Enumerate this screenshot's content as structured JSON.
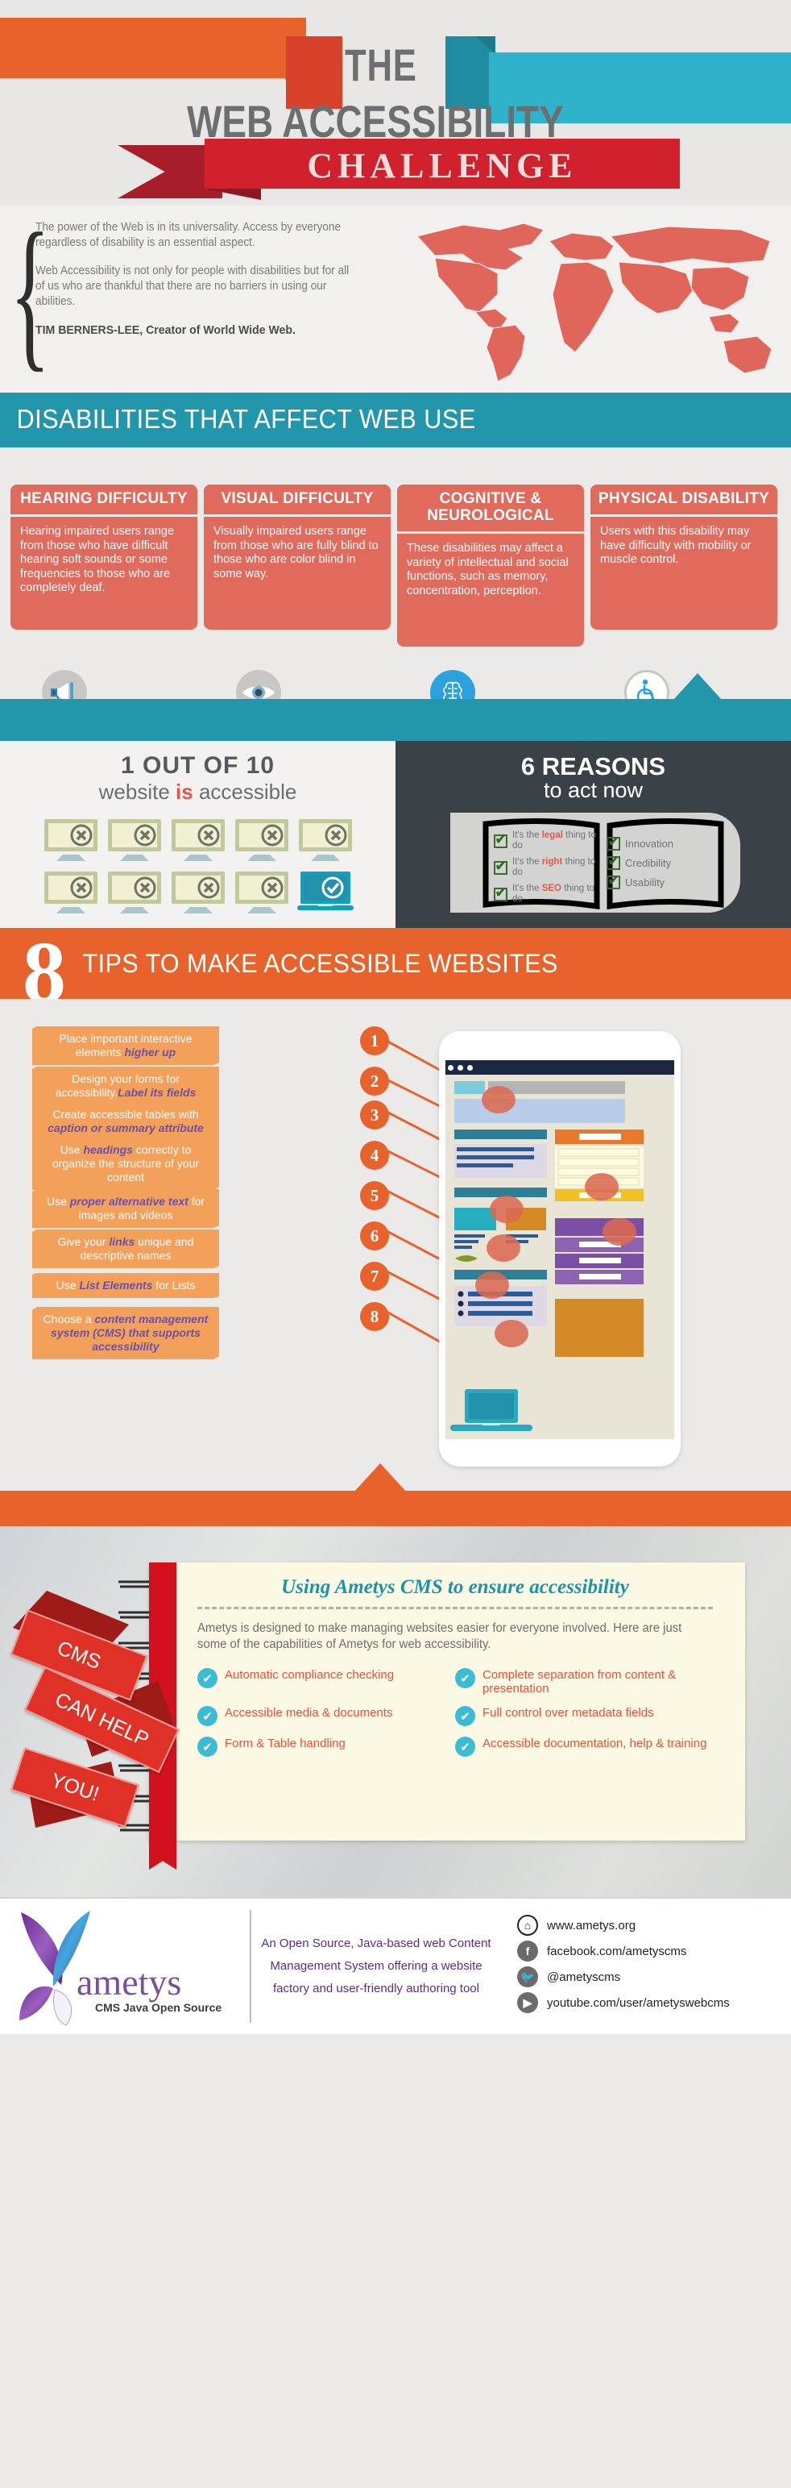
{
  "header": {
    "line1": "THE",
    "line2": "WEB ACCESSIBILITY",
    "ribbon": "CHALLENGE"
  },
  "quote": {
    "p1": "The power of the Web is in its universality. Access by everyone regardless of disability is an essential aspect.",
    "p2": "Web Accessibility is not only for people with disabilities but for all of us who are thankful that there are no barriers in using our abilities.",
    "author": "TIM BERNERS-LEE, Creator of World Wide Web.",
    "map_color": "#e0655a"
  },
  "disabilities": {
    "band_title": "DISABILITIES THAT AFFECT WEB USE",
    "band_color": "#2296ab",
    "card_color": "#e06a5c",
    "cards": [
      {
        "title": "HEARING DIFFICULTY",
        "body": "Hearing impaired users range from those who have difficult hearing soft sounds or some frequencies to those who are completely deaf.",
        "icon": "megaphone-icon"
      },
      {
        "title": "VISUAL DIFFICULTY",
        "body": "Visually impaired users range from those who are fully blind to those who are color blind in some way.",
        "icon": "eye-icon"
      },
      {
        "title": "COGNITIVE & NEUROLOGICAL",
        "body": "These disabilities may affect a variety of intellectual and social functions, such as memory, concentration, perception.",
        "icon": "brain-icon"
      },
      {
        "title": "PHYSICAL DISABILITY",
        "body": "Users with this disability may have difficulty with mobility or muscle control.",
        "icon": "wheelchair-icon"
      }
    ]
  },
  "stats": {
    "left": {
      "headline": "1 OUT OF 10",
      "sub_pre": "website ",
      "sub_hl": "is",
      "sub_post": " accessible",
      "total_monitors": 10,
      "accessible_count": 1,
      "inaccessible_count": 9
    },
    "right": {
      "headline": "6 REASONS",
      "sub": "to act now",
      "bg_color": "#3b4247",
      "reasons_left": [
        {
          "pre": "It's the ",
          "hl": "legal",
          "post": " thing to do"
        },
        {
          "pre": "It's the ",
          "hl": "right",
          "post": " thing to do"
        },
        {
          "pre": "It's the ",
          "hl": "SEO",
          "post": " thing to do"
        }
      ],
      "reasons_right": [
        {
          "pre": "",
          "hl": "",
          "post": "Innovation"
        },
        {
          "pre": "",
          "hl": "",
          "post": "Credibility"
        },
        {
          "pre": "",
          "hl": "",
          "post": "Usability"
        }
      ]
    }
  },
  "tips": {
    "big_number": "8",
    "band_title": "TIPS TO MAKE ACCESSIBLE WEBSITES",
    "band_color": "#e8622c",
    "items": [
      {
        "num": "1",
        "pre": "Place important interactive elements ",
        "em": "higher up",
        "post": ""
      },
      {
        "num": "2",
        "pre": "Design your forms for accessibility.",
        "em": "Label its fields",
        "post": ""
      },
      {
        "num": "3",
        "pre": "Create accessible tables with ",
        "em": "caption or summary attribute",
        "post": ""
      },
      {
        "num": "4",
        "pre": "Use ",
        "em": "headings",
        "post": " correctly to organize the structure of your content"
      },
      {
        "num": "5",
        "pre": "Use ",
        "em": "proper alternative text",
        "post": " for images and videos"
      },
      {
        "num": "6",
        "pre": "Give your ",
        "em": "links",
        "post": " unique and descriptive names"
      },
      {
        "num": "7",
        "pre": "Use ",
        "em": "List Elements",
        "post": " for Lists"
      },
      {
        "num": "8",
        "pre": "Choose a ",
        "em": "content management system (CMS) that supports accessibility",
        "post": ""
      }
    ]
  },
  "cms": {
    "ribbon_lines": [
      "CMS",
      "CAN HELP",
      "YOU!"
    ],
    "title": "Using Ametys CMS to ensure accessibility",
    "paragraph": "Ametys is designed to make managing websites easier for everyone involved. Here are just some of the capabilities of Ametys for web accessibility.",
    "features": [
      "Automatic compliance checking",
      "Complete separation from content & presentation",
      "Accessible media & documents",
      "Full control over metadata fields",
      "Form & Table handling",
      "Accessible documentation, help & training"
    ]
  },
  "footer": {
    "logo_name": "ametys",
    "logo_tagline": "CMS Java Open Source",
    "description": "An Open Source, Java-based web Content Management System offering a website factory and user-friendly authoring tool",
    "social": [
      {
        "icon": "home-icon",
        "label": "www.ametys.org"
      },
      {
        "icon": "facebook-icon",
        "label": "facebook.com/ametyscms"
      },
      {
        "icon": "twitter-icon",
        "label": "@ametyscms"
      },
      {
        "icon": "youtube-icon",
        "label": "youtube.com/user/ametyswebcms"
      }
    ]
  }
}
